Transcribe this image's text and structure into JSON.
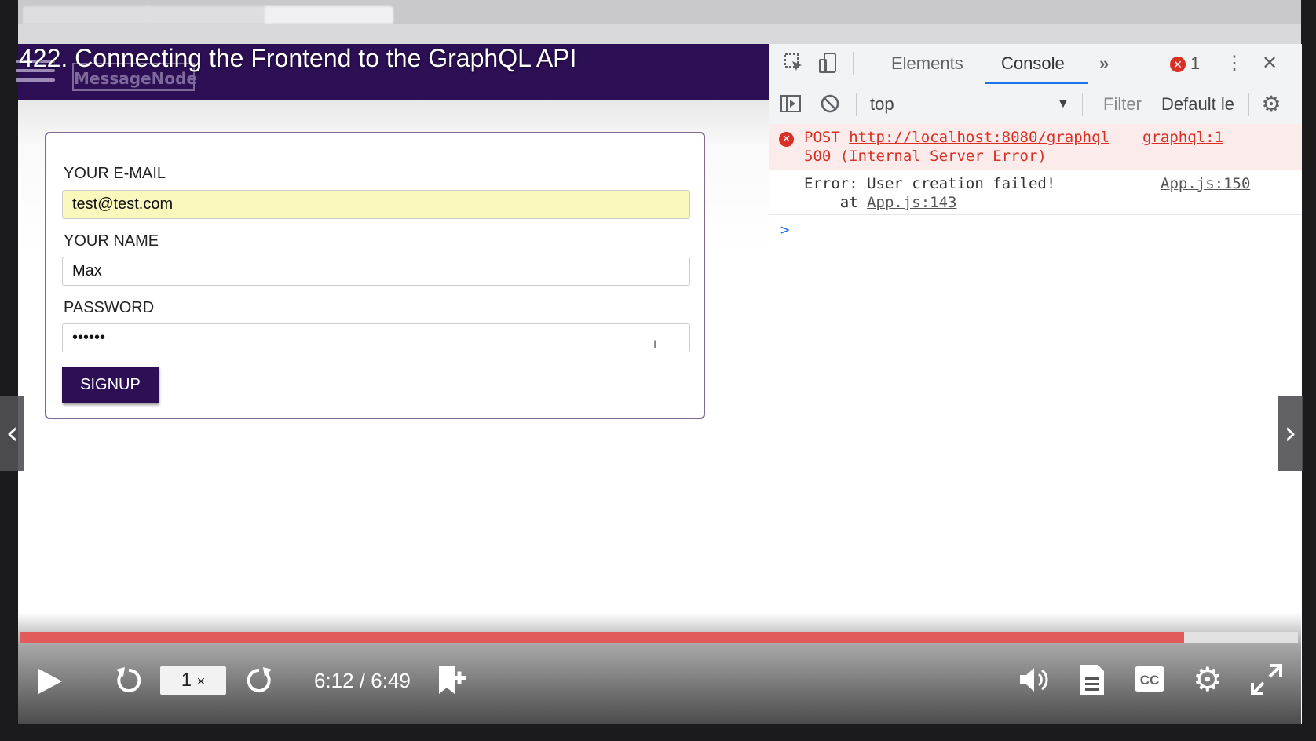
{
  "video": {
    "title": "422. Connecting the Frontend to the GraphQL API",
    "progress_fraction": 0.911,
    "time_display": "6:12 / 6:49",
    "speed_value": "1",
    "speed_suffix": "×"
  },
  "app": {
    "brand": "MessageNode",
    "form": {
      "email_label": "YOUR E-MAIL",
      "email_value": "test@test.com",
      "name_label": "YOUR NAME",
      "name_value": "Max",
      "password_label": "PASSWORD",
      "password_value": "••••••",
      "signup_label": "SIGNUP"
    }
  },
  "devtools": {
    "tabs": [
      "Elements",
      "Console"
    ],
    "more_tabs": "»",
    "error_count": "1",
    "context": "top",
    "filter_placeholder": "Filter",
    "levels": "Default le",
    "messages": {
      "error": {
        "method": "POST",
        "url": "http://localhost:8080/graphql",
        "source": "graphql:1",
        "status": "500 (Internal Server Error)"
      },
      "log": {
        "text": "Error: User creation failed!",
        "source": "App.js:150",
        "stack_prefix": "    at ",
        "stack_link": "App.js:143"
      }
    },
    "prompt": ">"
  },
  "colors": {
    "app_header": "#2d0f55",
    "progress_fill": "#e15b5b",
    "error_text": "#d93025",
    "tab_underline": "#1a73e8"
  }
}
